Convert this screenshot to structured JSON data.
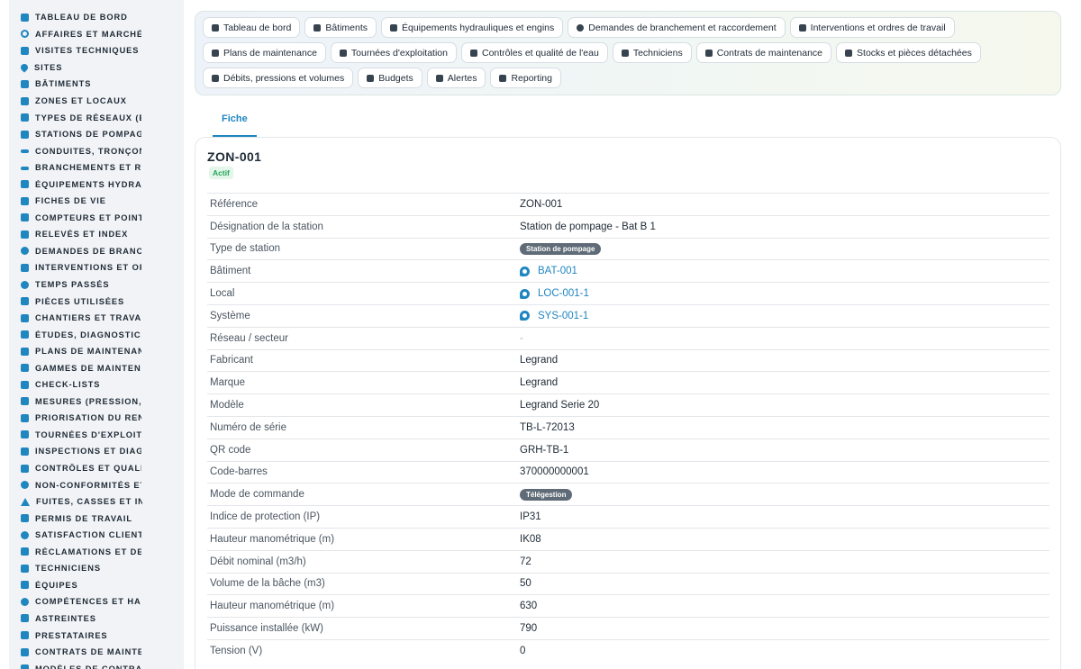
{
  "sidebar": {
    "items": [
      {
        "label": "TABLEAU DE BORD",
        "icon": "dashboard-icon"
      },
      {
        "label": "AFFAIRES ET MARCHÉS",
        "icon": "target-icon"
      },
      {
        "label": "VISITES TECHNIQUES ET",
        "icon": "clipboard-icon"
      },
      {
        "label": "SITES",
        "icon": "location-pin-icon"
      },
      {
        "label": "BÂTIMENTS",
        "icon": "building-icon"
      },
      {
        "label": "ZONES ET LOCAUX",
        "icon": "zones-icon"
      },
      {
        "label": "TYPES DE RÉSEAUX (EAU",
        "icon": "network-icon"
      },
      {
        "label": "STATIONS DE POMPAGE I",
        "icon": "grid-icon"
      },
      {
        "label": "CONDUITES, TRONÇONS",
        "icon": "pipe-icon"
      },
      {
        "label": "BRANCHEMENTS ET RAC",
        "icon": "connection-icon"
      },
      {
        "label": "ÉQUIPEMENTS HYDRAUL",
        "icon": "gears-icon"
      },
      {
        "label": "FICHES DE VIE",
        "icon": "history-icon"
      },
      {
        "label": "COMPTEURS ET POINTS I",
        "icon": "gauge-icon"
      },
      {
        "label": "RELEVÉS ET INDEX",
        "icon": "list-icon"
      },
      {
        "label": "DEMANDES DE BRANCHE",
        "icon": "question-icon"
      },
      {
        "label": "INTERVENTIONS ET ORDI",
        "icon": "clipboard-check-icon"
      },
      {
        "label": "TEMPS PASSÉS",
        "icon": "clock-icon"
      },
      {
        "label": "PIÈCES UTILISÉES",
        "icon": "parts-icon"
      },
      {
        "label": "CHANTIERS ET TRAVAUX",
        "icon": "hammer-icon"
      },
      {
        "label": "ÉTUDES, DIAGNOSTICS E",
        "icon": "flask-icon"
      },
      {
        "label": "PLANS DE MAINTENANCE",
        "icon": "calendar-icon"
      },
      {
        "label": "GAMMES DE MAINTENAN",
        "icon": "list-check-icon"
      },
      {
        "label": "CHECK-LISTS",
        "icon": "checklist-icon"
      },
      {
        "label": "MESURES (PRESSION, DÉ",
        "icon": "thermometer-icon"
      },
      {
        "label": "PRIORISATION DU RENOU",
        "icon": "chart-icon"
      },
      {
        "label": "TOURNÉES D'EXPLOITATI",
        "icon": "route-icon"
      },
      {
        "label": "INSPECTIONS ET DIAGNC",
        "icon": "search-icon"
      },
      {
        "label": "CONTRÔLES ET QUALITÉ",
        "icon": "clipboard-icon"
      },
      {
        "label": "NON-CONFORMITÉS ET A",
        "icon": "alert-circle-icon"
      },
      {
        "label": "FUITES, CASSES ET INCI",
        "icon": "warning-icon"
      },
      {
        "label": "PERMIS DE TRAVAIL",
        "icon": "document-icon"
      },
      {
        "label": "SATISFACTION CLIENT",
        "icon": "smile-icon"
      },
      {
        "label": "RÉCLAMATIONS ET DEMA",
        "icon": "comment-icon"
      },
      {
        "label": "TECHNICIENS",
        "icon": "helmet-icon"
      },
      {
        "label": "ÉQUIPES",
        "icon": "team-icon"
      },
      {
        "label": "COMPÉTENCES ET HABIL",
        "icon": "badge-icon"
      },
      {
        "label": "ASTREINTES",
        "icon": "phone-icon"
      },
      {
        "label": "PRESTATAIRES",
        "icon": "handshake-icon"
      },
      {
        "label": "CONTRATS DE MAINTENA",
        "icon": "contract-icon"
      },
      {
        "label": "MODÈLES DE CONTRATS",
        "icon": "template-icon"
      }
    ]
  },
  "topnav": {
    "buttons": [
      {
        "label": "Tableau de bord",
        "icon": "dashboard-icon"
      },
      {
        "label": "Bâtiments",
        "icon": "building-icon"
      },
      {
        "label": "Équipements hydrauliques et engins",
        "icon": "gears-icon"
      },
      {
        "label": "Demandes de branchement et raccordement",
        "icon": "question-icon"
      },
      {
        "label": "Interventions et ordres de travail",
        "icon": "clipboard-check-icon"
      },
      {
        "label": "Plans de maintenance",
        "icon": "calendar-icon"
      },
      {
        "label": "Tournées d'exploitation",
        "icon": "route-icon"
      },
      {
        "label": "Contrôles et qualité de l'eau",
        "icon": "clipboard-icon"
      },
      {
        "label": "Techniciens",
        "icon": "helmet-icon"
      },
      {
        "label": "Contrats de maintenance",
        "icon": "contract-icon"
      },
      {
        "label": "Stocks et pièces détachées",
        "icon": "network-icon"
      },
      {
        "label": "Débits, pressions et volumes",
        "icon": "bolt-icon"
      },
      {
        "label": "Budgets",
        "icon": "money-icon"
      },
      {
        "label": "Alertes",
        "icon": "bell-icon"
      },
      {
        "label": "Reporting",
        "icon": "pie-chart-icon"
      }
    ]
  },
  "tabs": [
    {
      "label": "Fiche"
    }
  ],
  "record": {
    "title": "ZON-001",
    "status": "Actif",
    "fields": [
      {
        "label": "Référence",
        "value": "ZON-001"
      },
      {
        "label": "Désignation de la station",
        "value": "Station de pompage - Bat B 1"
      },
      {
        "label": "Type de station",
        "value": "Station de pompage",
        "kind": "pill"
      },
      {
        "label": "Bâtiment",
        "value": "BAT-001",
        "kind": "link"
      },
      {
        "label": "Local",
        "value": "LOC-001-1",
        "kind": "link"
      },
      {
        "label": "Système",
        "value": "SYS-001-1",
        "kind": "link"
      },
      {
        "label": "Réseau / secteur",
        "value": "-",
        "kind": "empty"
      },
      {
        "label": "Fabricant",
        "value": "Legrand"
      },
      {
        "label": "Marque",
        "value": "Legrand"
      },
      {
        "label": "Modèle",
        "value": "Legrand Serie 20"
      },
      {
        "label": "Numéro de série",
        "value": "TB-L-72013"
      },
      {
        "label": "QR code",
        "value": "GRH-TB-1"
      },
      {
        "label": "Code-barres",
        "value": "370000000001"
      },
      {
        "label": "Mode de commande",
        "value": "Télégestion",
        "kind": "pill"
      },
      {
        "label": "Indice de protection (IP)",
        "value": "IP31"
      },
      {
        "label": "Hauteur manométrique (m)",
        "value": "IK08"
      },
      {
        "label": "Débit nominal (m3/h)",
        "value": "72"
      },
      {
        "label": "Volume de la bâche (m3)",
        "value": "50"
      },
      {
        "label": "Hauteur manométrique (m)",
        "value": "630"
      },
      {
        "label": "Puissance installée (kW)",
        "value": "790"
      },
      {
        "label": "Tension (V)",
        "value": "0"
      }
    ]
  },
  "colors": {
    "accent": "#1f86c0",
    "status_active": "#22a55b",
    "pill": "#5f6b76",
    "sidebar_bg": "#f1f3f6"
  }
}
